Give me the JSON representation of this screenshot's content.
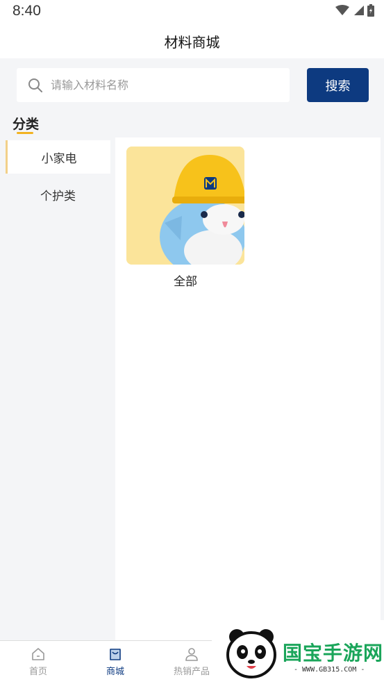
{
  "status": {
    "time": "8:40"
  },
  "header": {
    "title": "材料商城"
  },
  "search": {
    "placeholder": "请输入材料名称",
    "button_label": "搜索"
  },
  "section": {
    "title": "分类"
  },
  "categories": [
    {
      "label": "小家电",
      "active": true
    },
    {
      "label": "个护类",
      "active": false
    }
  ],
  "products": [
    {
      "label": "全部"
    }
  ],
  "tabs": [
    {
      "label": "首页",
      "icon": "home-icon",
      "active": false
    },
    {
      "label": "商城",
      "icon": "shop-icon",
      "active": true
    },
    {
      "label": "热销产品",
      "icon": "person-icon",
      "active": false
    }
  ],
  "watermark": {
    "text": "国宝手游网",
    "url": "- WWW.GB315.COM -"
  },
  "colors": {
    "accent": "#0d3a80",
    "highlight": "#f2b321",
    "background": "#f4f5f7"
  }
}
